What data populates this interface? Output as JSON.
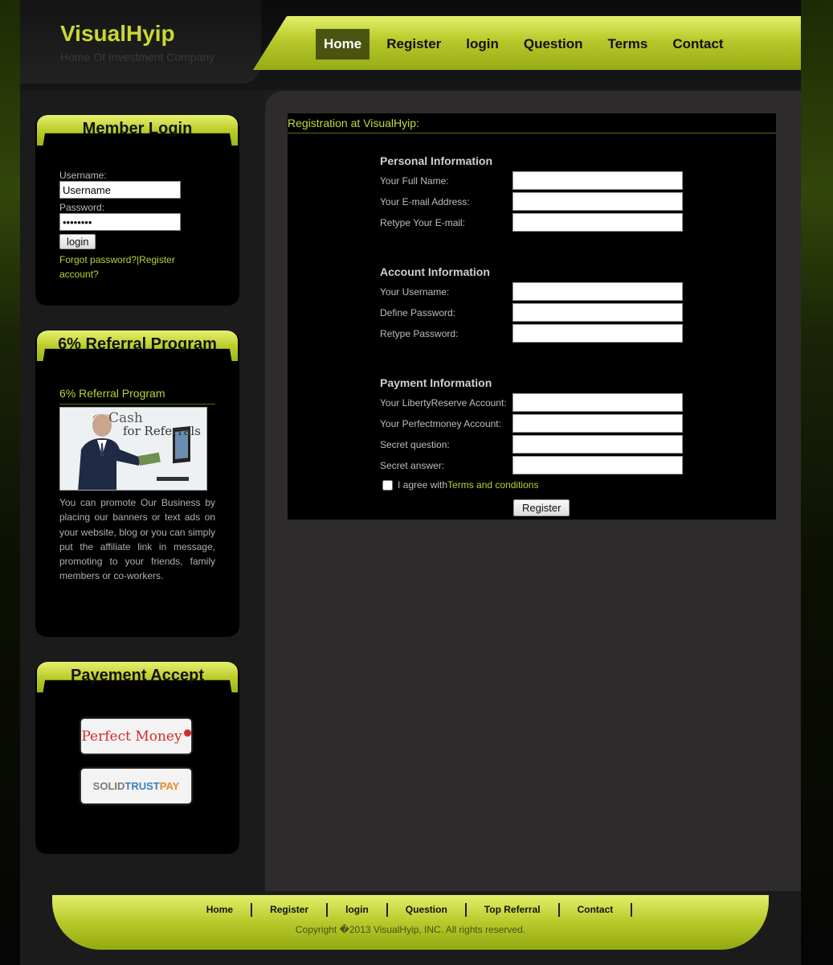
{
  "brand": {
    "title": "VisualHyip",
    "subtitle": "Home Of Investment Company"
  },
  "nav": [
    "Home",
    "Register",
    "login",
    "Question",
    "Terms",
    "Contact"
  ],
  "member_login": {
    "title": "Member Login",
    "username_label": "Username:",
    "username_value": "Username",
    "password_label": "Password:",
    "password_value": "password",
    "button": "login",
    "forgot_link": "Forgot password?",
    "register_link": "|Register account?"
  },
  "referral": {
    "title": "6% Referral Program",
    "heading": "6% Referral Program",
    "image_caption_1": "Cash",
    "image_caption_2": "for Referrals",
    "text": "You can promote Our Business by placing our banners or text ads on your website, blog or you can simply put the affiliate link in message, promoting to your friends, family members or co-workers."
  },
  "payment": {
    "title": "Payement Accept",
    "perfect_money": "Perfect Money",
    "stp_solid": "SOLID",
    "stp_trust": "TRUST",
    "stp_pay": "PAY"
  },
  "registration": {
    "title": "Registration at VisualHyip:",
    "sections": {
      "personal": "Personal Information",
      "account": "Account Information",
      "payment": "Payment Information"
    },
    "fields": {
      "full_name": "Your Full Name:",
      "email": "Your E-mail Address:",
      "retype_email": "Retype Your E-mail:",
      "username": "Your Username:",
      "password": "Define Password:",
      "retype_password": "Retype Password:",
      "liberty": "Your LibertyReserve Account:",
      "perfectmoney": "Your Perfectmoney Account:",
      "secret_q": "Secret question:",
      "secret_a": "Secret answer:"
    },
    "agree_text": "I agree with ",
    "terms_link": "Terms and conditions",
    "submit": "Register"
  },
  "footer": {
    "links": [
      "Home",
      "Register",
      "login",
      "Question",
      "Top Referral",
      "Contact"
    ],
    "copyright": "Copyright �2013 VisualHyip, INC. All rights reserved."
  },
  "colors": {
    "accent": "#c8d832",
    "dark": "#000000",
    "panel": "#2d2b2b"
  }
}
